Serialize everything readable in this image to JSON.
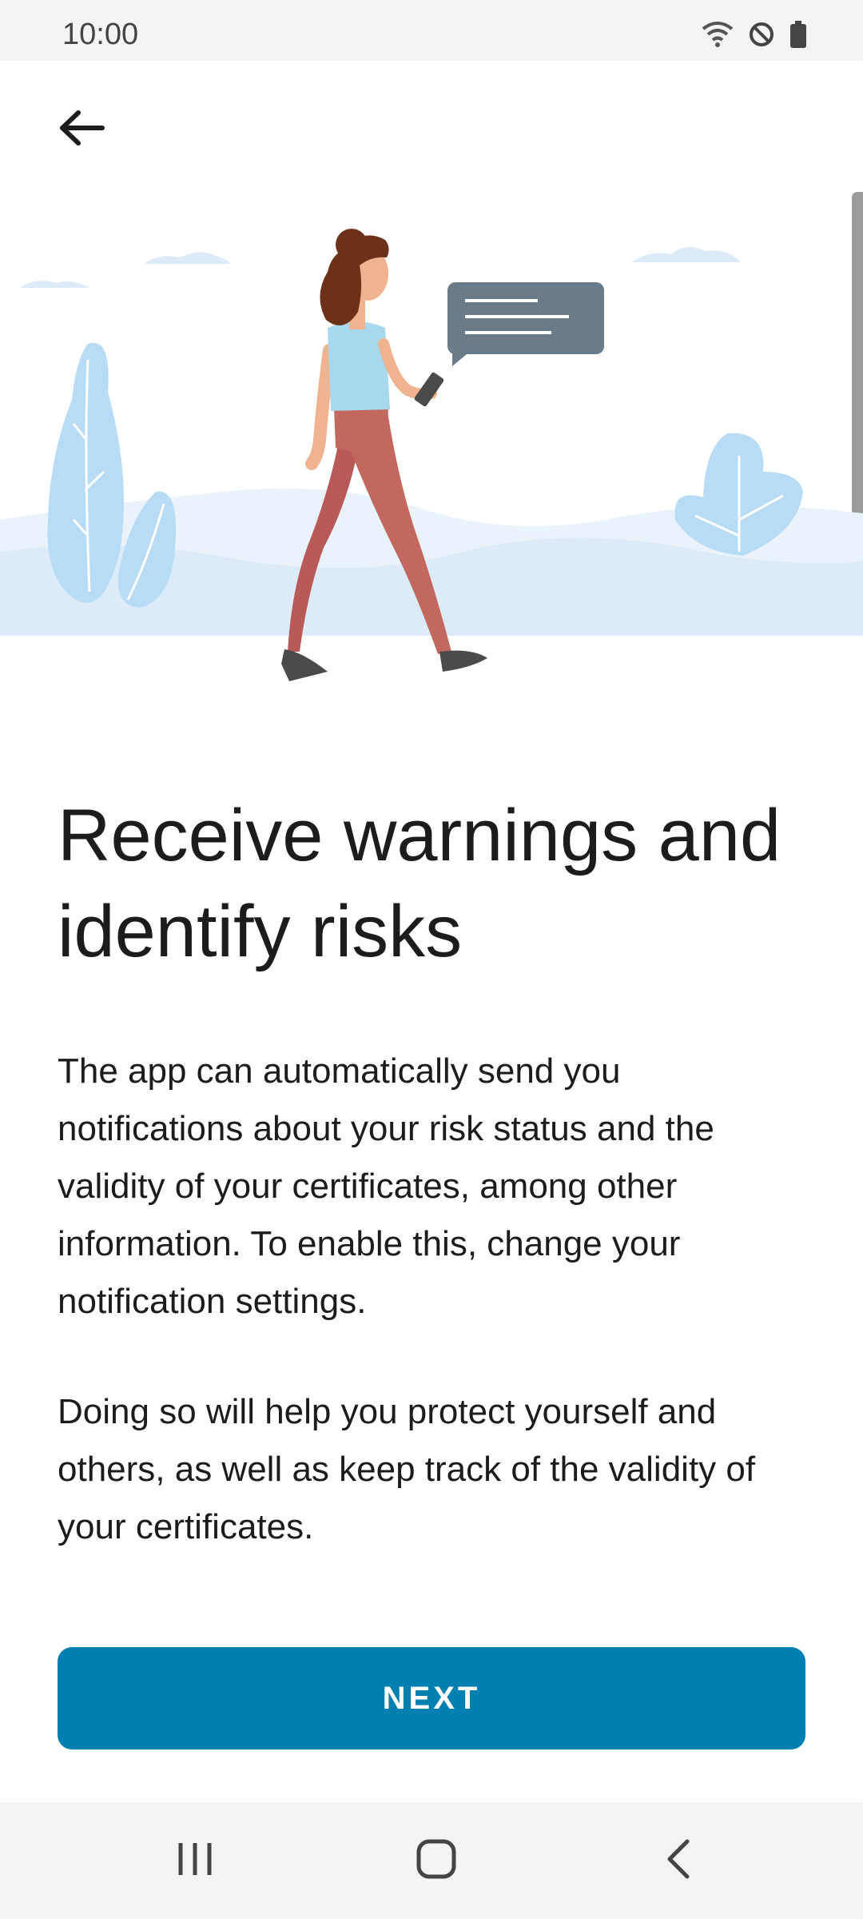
{
  "status_bar": {
    "time": "10:00",
    "icons": [
      "wifi-icon",
      "do-not-disturb-icon",
      "battery-icon"
    ]
  },
  "nav": {
    "back_icon": "arrow-left-icon"
  },
  "illustration": {
    "subject": "woman-walking-with-phone-illustration",
    "colors": {
      "hills": "#dcebf7",
      "plants": "#b8dcf6",
      "bubble": "#6a7b8a",
      "shirt": "#a8d8ee",
      "pants": "#c2685f",
      "hair": "#6b3219"
    }
  },
  "content": {
    "title": "Receive warnings and identify risks",
    "paragraph1": "The app can automatically send you notifications about your risk status and the validity of your certificates, among other information. To enable this, change your notification settings.",
    "paragraph2": "Doing so will help you protect yourself and others, as well as keep track of the validity of your certificates."
  },
  "actions": {
    "next_label": "NEXT"
  },
  "system_nav": {
    "recents_icon": "recents-icon",
    "home_icon": "home-icon",
    "back_icon": "system-back-icon"
  },
  "theme": {
    "accent": "#0080b0",
    "text": "#1c1c1c",
    "bars": "#f4f4f4"
  }
}
